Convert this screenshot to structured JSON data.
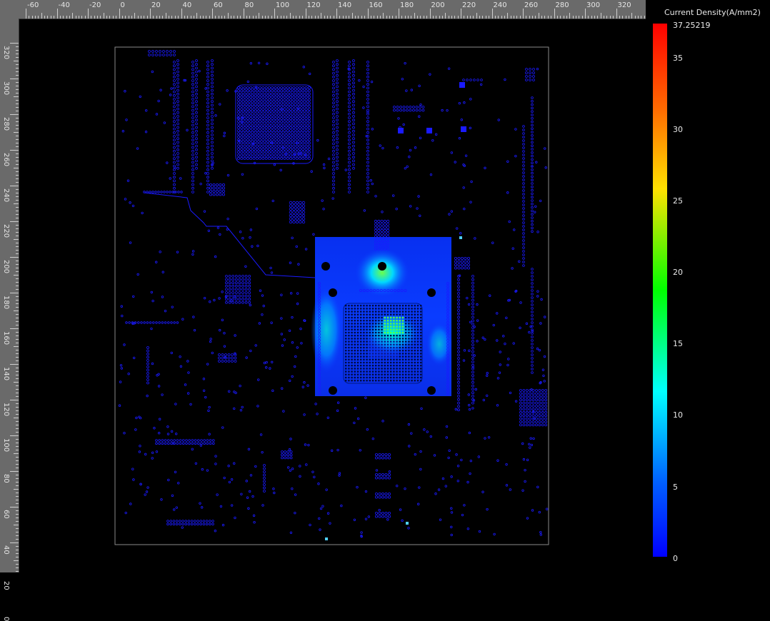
{
  "ruler": {
    "top_labels": [
      "-60",
      "-40",
      "-20",
      "0",
      "20",
      "40",
      "60",
      "80",
      "100",
      "120",
      "140",
      "160",
      "180",
      "200",
      "220",
      "240",
      "260",
      "280",
      "300",
      "320"
    ],
    "left_labels": [
      "320",
      "300",
      "280",
      "260",
      "240",
      "220",
      "200",
      "180",
      "160",
      "140",
      "120",
      "100",
      "80",
      "60",
      "40",
      "20",
      "0"
    ]
  },
  "legend": {
    "title": "Current Density(A/mm2)",
    "max_label": "37.25219",
    "labels": [
      "35",
      "30",
      "25",
      "20",
      "15",
      "10",
      "5",
      "0"
    ],
    "colors": {
      "max": "#ff0000",
      "mid": "#00ff00",
      "min": "#0000ff"
    }
  },
  "board": {
    "outline_color": "#8a8a8a",
    "via_color": "#1a1aff",
    "heatmap_base_color": "#0a3cff"
  }
}
